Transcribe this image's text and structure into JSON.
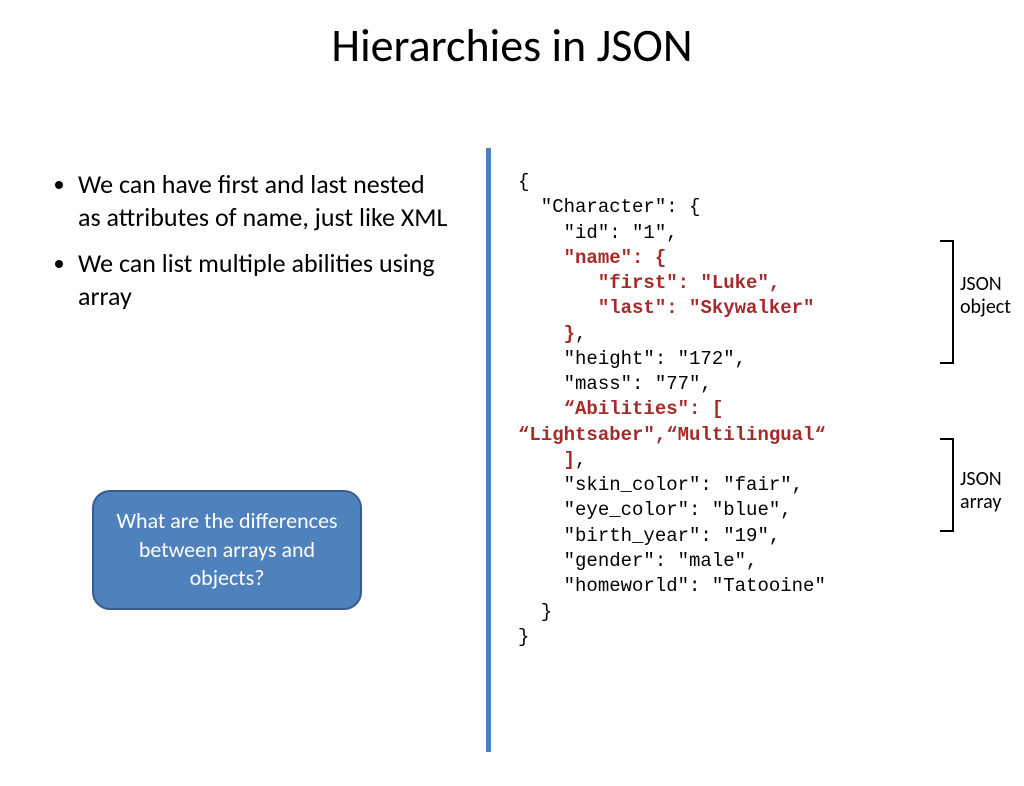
{
  "title": "Hierarchies in JSON",
  "bullets": [
    "We can have first and last nested as attributes of name, just like XML",
    "We can list multiple abilities using array"
  ],
  "callout": "What are the differences between arrays and objects?",
  "labels": {
    "obj": "JSON\nobject",
    "arr": "JSON\narray"
  },
  "code_lines": [
    [
      {
        "t": "{",
        "h": 0
      }
    ],
    [
      {
        "t": "  \"Character\": {",
        "h": 0
      }
    ],
    [
      {
        "t": "    \"id\": \"1\",",
        "h": 0
      }
    ],
    [
      {
        "t": "    ",
        "h": 0
      },
      {
        "t": "\"name\": {",
        "h": 1
      }
    ],
    [
      {
        "t": "       ",
        "h": 0
      },
      {
        "t": "\"first\": \"Luke\",",
        "h": 1
      }
    ],
    [
      {
        "t": "       ",
        "h": 0
      },
      {
        "t": "\"last\": \"Skywalker\"",
        "h": 1
      }
    ],
    [
      {
        "t": "    ",
        "h": 0
      },
      {
        "t": "}",
        "h": 1
      },
      {
        "t": ",",
        "h": 0
      }
    ],
    [
      {
        "t": "    \"height\": \"172\",",
        "h": 0
      }
    ],
    [
      {
        "t": "    \"mass\": \"77\",",
        "h": 0
      }
    ],
    [
      {
        "t": "    ",
        "h": 0
      },
      {
        "t": "“Abilities\": [",
        "h": 1
      }
    ],
    [
      {
        "t": "“Lightsaber\",“Multilingual“",
        "h": 1
      }
    ],
    [
      {
        "t": "    ",
        "h": 0
      },
      {
        "t": "]",
        "h": 1
      },
      {
        "t": ",",
        "h": 0
      }
    ],
    [
      {
        "t": "    \"skin_color\": \"fair\",",
        "h": 0
      }
    ],
    [
      {
        "t": "    \"eye_color\": \"blue\",",
        "h": 0
      }
    ],
    [
      {
        "t": "    \"birth_year\": \"19\",",
        "h": 0
      }
    ],
    [
      {
        "t": "    \"gender\": \"male\",",
        "h": 0
      }
    ],
    [
      {
        "t": "    \"homeworld\": \"Tatooine\"",
        "h": 0
      }
    ],
    [
      {
        "t": "  }",
        "h": 0
      }
    ],
    [
      {
        "t": "}",
        "h": 0
      }
    ]
  ]
}
